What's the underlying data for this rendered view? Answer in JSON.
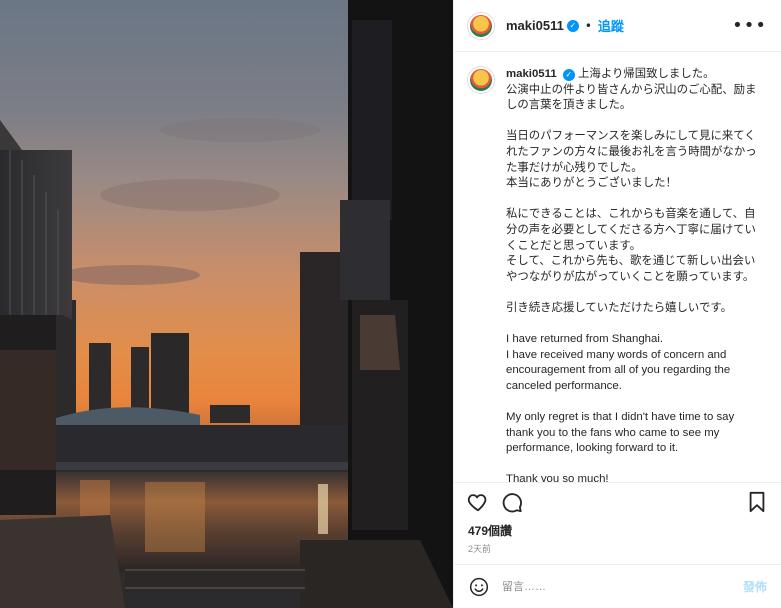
{
  "post": {
    "username": "maki0511",
    "verified_icon": "verified-badge-icon",
    "separator": "•",
    "follow_label": "追蹤",
    "more_label": "•••"
  },
  "caption": {
    "username": "maki0511",
    "paragraphs": [
      "上海より帰国致しました。\n公演中止の件より皆さんから沢山のご心配、励ましの言葉を頂きました。",
      "当日のパフォーマンスを楽しみにして見に来てくれたファンの方々に最後お礼を言う時間がなかった事だけが心残りでした。\n本当にありがとうございました！",
      "私にできることは、これからも音楽を通して、自分の声を必要としてくださる方へ丁寧に届けていくことだと思っています。\nそして、これから先も、歌を通じて新しい出会いやつながりが広がっていくことを願っています。",
      "引き続き応援していただけたら嬉しいです。",
      "I have returned from Shanghai.\nI have received many words of concern and encouragement from all of you regarding the canceled performance.",
      "My only regret is that I didn't have time to say thank you to the fans who came to see my performance, looking forward to it.",
      "Thank you so much!"
    ]
  },
  "stats": {
    "likes": "479個讚",
    "time": "2天前"
  },
  "comment_box": {
    "placeholder": "留言……",
    "post_label": "發佈"
  },
  "icons": {
    "like": "heart-icon",
    "comment": "comment-icon",
    "save": "bookmark-icon",
    "emoji": "emoji-icon"
  },
  "colors": {
    "accent": "#0095f6",
    "post_disabled": "#b2dffc",
    "text": "#262626",
    "muted": "#8e8e8e"
  }
}
